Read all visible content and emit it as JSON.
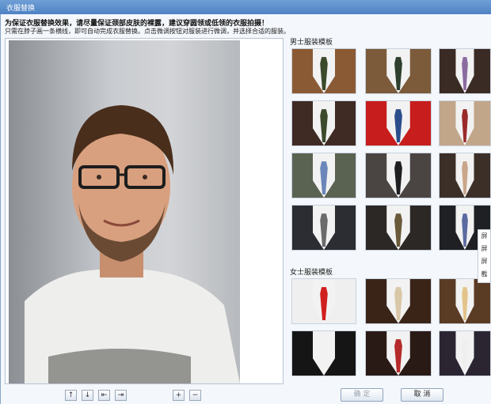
{
  "window": {
    "title": "衣服替换"
  },
  "hints": {
    "line1": "为保证衣服替换效果，请尽量保证颈部皮肤的裸露，建议穿圆领或低领的衣服拍摄！",
    "line2": "只需在脖子画一条横线，即可自动完成衣服替换。点击微调按钮对服装进行微调，并选择合适的服装。"
  },
  "sections": {
    "men": "男士服装模板",
    "women": "女士服装模板"
  },
  "toolbar": {
    "up": "↑",
    "down": "↓",
    "left": "⇤",
    "right": "⇥",
    "zoom_in": "+",
    "zoom_out": "−"
  },
  "buttons": {
    "confirm": "确 定",
    "cancel": "取 消"
  },
  "side_menu": [
    "屏",
    "屏",
    "屏",
    "截"
  ],
  "colors": {
    "titlebar": "#5a8bcc",
    "suit_brown": "#7a4a2d",
    "suit_dark": "#2a2624",
    "suit_black": "#1b1c20",
    "shirt": "#f2f2f2"
  },
  "men_templates": [
    {
      "bg": "#8a5a35",
      "tie": "#3a4a2a"
    },
    {
      "bg": "#7b5b3a",
      "tie": "#2e3f2e"
    },
    {
      "bg": "#3b2b25",
      "tie": "#8b6aa0"
    },
    {
      "bg": "#3f2b24",
      "tie": "#3a4a2a"
    },
    {
      "bg": "#c71d1d",
      "tie": "#2b4d8b"
    },
    {
      "bg": "#c2a68a",
      "tie": "#9a2a2a"
    },
    {
      "bg": "#5a6352",
      "tie": "#6b86b8"
    },
    {
      "bg": "#4a4543",
      "tie": "#1f1f22"
    },
    {
      "bg": "#3c2f28",
      "tie": "#c9a58a"
    },
    {
      "bg": "#2c2d33",
      "tie": "#6a6a6a"
    },
    {
      "bg": "#2c2826",
      "tie": "#6a5a3a"
    },
    {
      "bg": "#1e2024",
      "tie": "#5b6aa0"
    }
  ],
  "women_templates": [
    {
      "bg": "#efefef",
      "tie": "#d01f1f"
    },
    {
      "bg": "#3a2418",
      "tie": "#d9c7a8"
    },
    {
      "bg": "#5a3b24",
      "tie": "#e2c48a"
    },
    {
      "bg": "#151515",
      "tie": "#f2f2f2"
    },
    {
      "bg": "#2a1a16",
      "tie": "#b52a2a"
    },
    {
      "bg": "#2b2532",
      "tie": "#efefef"
    }
  ]
}
